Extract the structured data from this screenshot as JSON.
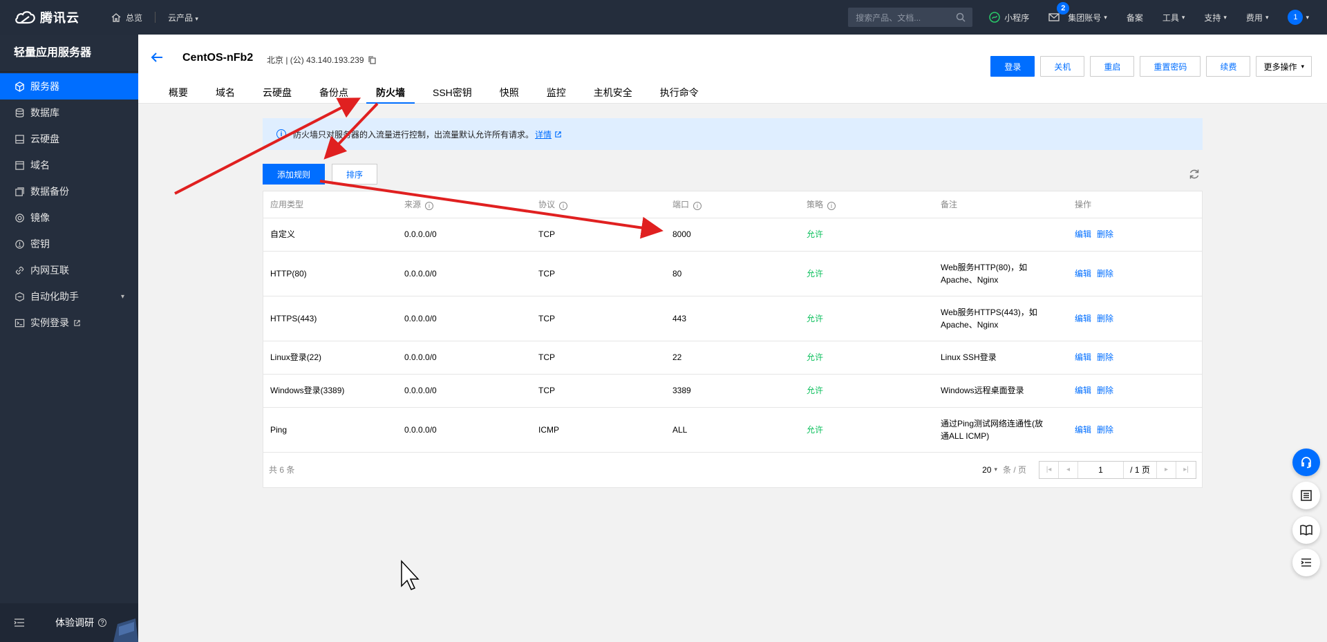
{
  "topbar": {
    "brand": "腾讯云",
    "home": "总览",
    "products": "云产品",
    "search_placeholder": "搜索产品、文档...",
    "miniprogram": "小程序",
    "mail_badge": "2",
    "group_account": "集团账号",
    "beian": "备案",
    "tools": "工具",
    "support": "支持",
    "billing": "费用",
    "avatar_text": "1"
  },
  "sidebar": {
    "title": "轻量应用服务器",
    "items": [
      {
        "label": "服务器",
        "icon": "cube-icon"
      },
      {
        "label": "数据库",
        "icon": "database-icon"
      },
      {
        "label": "云硬盘",
        "icon": "disk-icon"
      },
      {
        "label": "域名",
        "icon": "domain-icon"
      },
      {
        "label": "数据备份",
        "icon": "backup-icon"
      },
      {
        "label": "镜像",
        "icon": "image-icon"
      },
      {
        "label": "密钥",
        "icon": "key-icon"
      },
      {
        "label": "内网互联",
        "icon": "network-icon"
      },
      {
        "label": "自动化助手",
        "icon": "automation-icon"
      },
      {
        "label": "实例登录",
        "icon": "terminal-icon"
      }
    ],
    "footer": "体验调研"
  },
  "header": {
    "instance_name": "CentOS-nFb2",
    "location": "北京 | (公) 43.140.193.239",
    "buttons": {
      "login": "登录",
      "shutdown": "关机",
      "restart": "重启",
      "reset_password": "重置密码",
      "renew": "续费",
      "more": "更多操作"
    },
    "tabs": [
      "概要",
      "域名",
      "云硬盘",
      "备份点",
      "防火墙",
      "SSH密钥",
      "快照",
      "监控",
      "主机安全",
      "执行命令"
    ],
    "active_tab": "防火墙"
  },
  "notice": {
    "text": "防火墙只对服务器的入流量进行控制，出流量默认允许所有请求。",
    "link": "详情"
  },
  "toolbar": {
    "add_rule": "添加规则",
    "sort": "排序"
  },
  "table": {
    "headers": [
      "应用类型",
      "来源",
      "协议",
      "端口",
      "策略",
      "备注",
      "操作"
    ],
    "rows": [
      {
        "type": "自定义",
        "source": "0.0.0.0/0",
        "protocol": "TCP",
        "port": "8000",
        "policy": "允许",
        "note": ""
      },
      {
        "type": "HTTP(80)",
        "source": "0.0.0.0/0",
        "protocol": "TCP",
        "port": "80",
        "policy": "允许",
        "note": "Web服务HTTP(80)，如Apache、Nginx"
      },
      {
        "type": "HTTPS(443)",
        "source": "0.0.0.0/0",
        "protocol": "TCP",
        "port": "443",
        "policy": "允许",
        "note": "Web服务HTTPS(443)，如Apache、Nginx"
      },
      {
        "type": "Linux登录(22)",
        "source": "0.0.0.0/0",
        "protocol": "TCP",
        "port": "22",
        "policy": "允许",
        "note": "Linux SSH登录"
      },
      {
        "type": "Windows登录(3389)",
        "source": "0.0.0.0/0",
        "protocol": "TCP",
        "port": "3389",
        "policy": "允许",
        "note": "Windows远程桌面登录"
      },
      {
        "type": "Ping",
        "source": "0.0.0.0/0",
        "protocol": "ICMP",
        "port": "ALL",
        "policy": "允许",
        "note": "通过Ping测试网络连通性(放通ALL ICMP)"
      }
    ],
    "op_edit": "编辑",
    "op_delete": "删除"
  },
  "pager": {
    "total": "共 6 条",
    "page_size": "20",
    "page_size_unit": "条 / 页",
    "current_page": "1",
    "total_pages": "/ 1 页"
  },
  "colors": {
    "accent": "#006eff",
    "allow": "#0abf5b",
    "annotation": "#e02020"
  }
}
